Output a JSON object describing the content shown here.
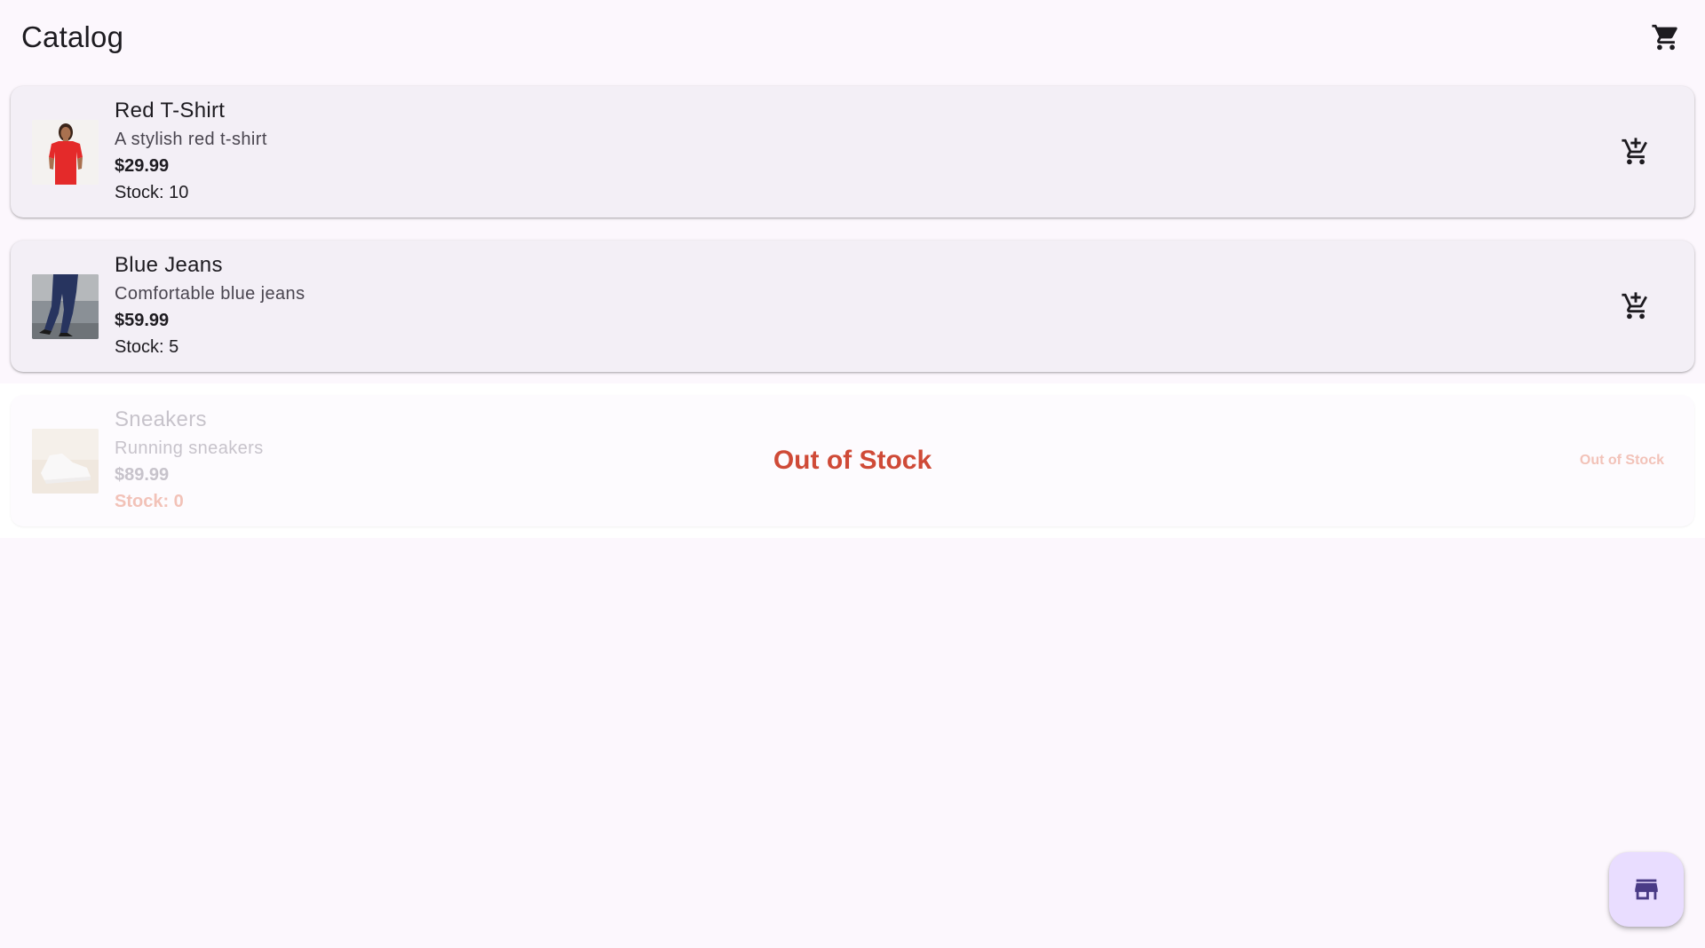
{
  "appbar": {
    "title": "Catalog",
    "cart_icon": "shopping-cart-icon"
  },
  "products": [
    {
      "name": "Red T-Shirt",
      "description": "A stylish red t-shirt",
      "price": "$29.99",
      "stock": "Stock: 10",
      "image": "red-tshirt-thumbnail",
      "action_icon": "add-shopping-cart-icon"
    },
    {
      "name": "Blue Jeans",
      "description": "Comfortable blue jeans",
      "price": "$59.99",
      "stock": "Stock: 5",
      "image": "blue-jeans-thumbnail",
      "action_icon": "add-shopping-cart-icon"
    },
    {
      "name": "Sneakers",
      "description": "Running sneakers",
      "price": "$89.99",
      "stock": "Stock: 0",
      "image": "sneakers-thumbnail",
      "overlay_label": "Out of Stock",
      "status_label": "Out of Stock"
    }
  ],
  "fab": {
    "icon": "storefront-icon"
  },
  "colors": {
    "background": "#fcf7fd",
    "card": "#f3eff6",
    "out_of_stock": "#cf4a37",
    "fab": "#e9ddff",
    "fab_icon": "#4a3b86"
  }
}
